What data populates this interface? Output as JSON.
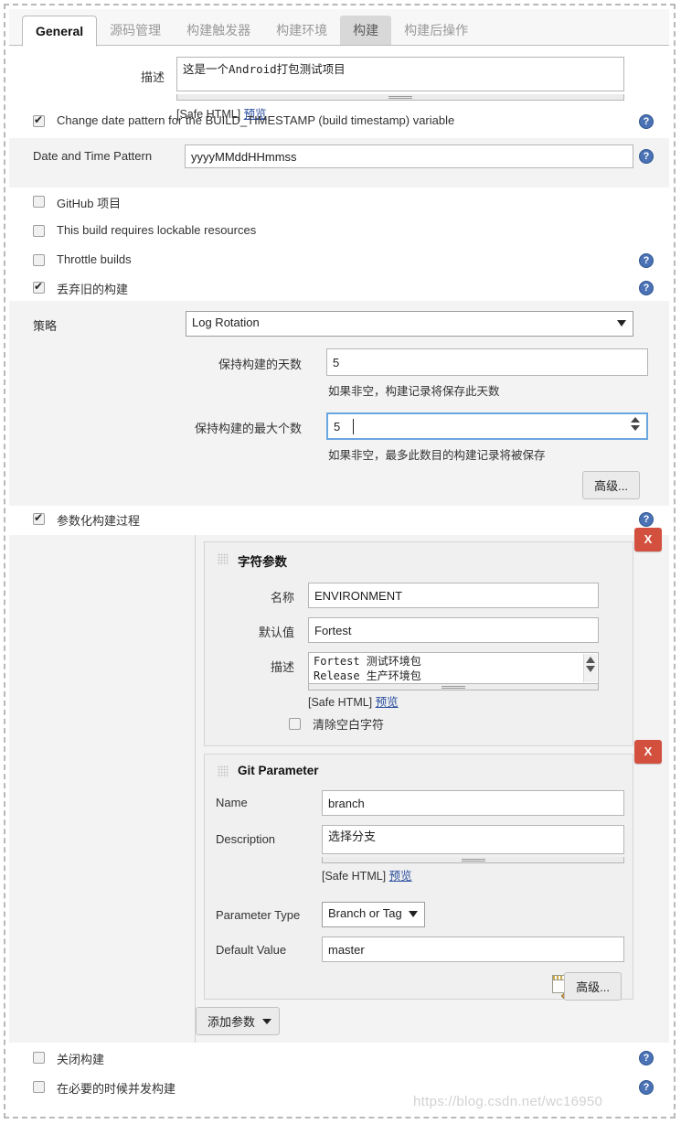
{
  "tabs": [
    {
      "label": "General",
      "state": "active"
    },
    {
      "label": "源码管理",
      "state": "normal"
    },
    {
      "label": "构建触发器",
      "state": "normal"
    },
    {
      "label": "构建环境",
      "state": "normal"
    },
    {
      "label": "构建",
      "state": "hover"
    },
    {
      "label": "构建后操作",
      "state": "normal"
    }
  ],
  "description": {
    "label": "描述",
    "value": "这是一个Android打包测试项目",
    "safe_html": "[Safe HTML]",
    "preview_link": "预览"
  },
  "build_timestamp": {
    "checkbox_label": "Change date pattern for the BUILD_TIMESTAMP (build timestamp) variable",
    "checked": true,
    "pattern_label": "Date and Time Pattern",
    "pattern_value": "yyyyMMddHHmmss"
  },
  "checkboxes": {
    "github": {
      "label": "GitHub 项目",
      "checked": false
    },
    "lockable": {
      "label": "This build requires lockable resources",
      "checked": false
    },
    "throttle": {
      "label": "Throttle builds",
      "checked": false
    },
    "discard": {
      "label": "丢弃旧的构建",
      "checked": true
    },
    "parameterized": {
      "label": "参数化构建过程",
      "checked": true
    },
    "disable": {
      "label": "关闭构建",
      "checked": false
    },
    "concurrent": {
      "label": "在必要的时候并发构建",
      "checked": false
    }
  },
  "log_rotation": {
    "strategy_label": "策略",
    "strategy_value": "Log Rotation",
    "days_label": "保持构建的天数",
    "days_value": "5",
    "days_hint": "如果非空，构建记录将保存此天数",
    "max_label": "保持构建的最大个数",
    "max_value": "5",
    "max_hint": "如果非空，最多此数目的构建记录将被保存",
    "advanced_button": "高级..."
  },
  "parameters": {
    "string_param": {
      "title": "字符参数",
      "delete_label": "X",
      "name_label": "名称",
      "name_value": "ENVIRONMENT",
      "default_label": "默认值",
      "default_value": "Fortest",
      "desc_label": "描述",
      "desc_line1": "Fortest 测试环境包",
      "desc_line2": "Release 生产环境包",
      "safe_html": "[Safe HTML]",
      "preview_link": "预览",
      "trim_label": "清除空白字符",
      "trim_checked": false
    },
    "git_param": {
      "title": "Git Parameter",
      "delete_label": "X",
      "name_label": "Name",
      "name_value": "branch",
      "desc_label": "Description",
      "desc_value": "选择分支",
      "safe_html": "[Safe HTML]",
      "preview_link": "预览",
      "type_label": "Parameter Type",
      "type_value": "Branch or Tag",
      "default_label": "Default Value",
      "default_value": "master",
      "advanced_button": "高级..."
    },
    "add_param_button": "添加参数"
  },
  "help_glyph": "?",
  "watermark": "https://blog.csdn.net/wc16950",
  "colors": {
    "accent": "#4a72b5",
    "delete": "#d3503f",
    "panel": "#f0f0f0",
    "focus": "#6aa6e0"
  }
}
